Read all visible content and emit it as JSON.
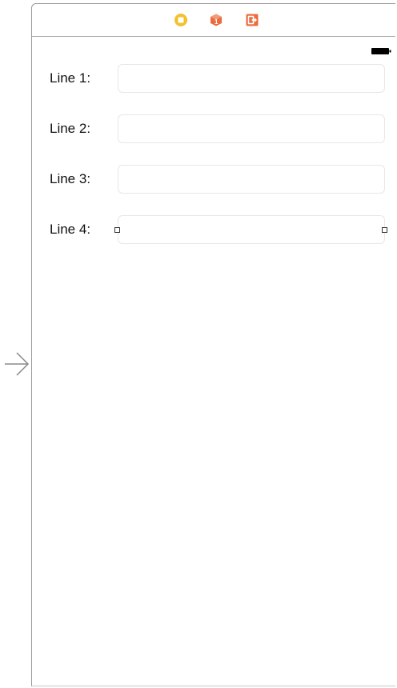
{
  "canvas": {
    "entry_arrow_icon": "entry-point-arrow-icon",
    "scene": {
      "dock": {
        "icons": [
          {
            "name": "view-controller-icon",
            "color": "#F2C12E"
          },
          {
            "name": "first-responder-icon",
            "color": "#EC6A3C"
          },
          {
            "name": "exit-icon",
            "color": "#EC6A3C"
          }
        ]
      },
      "status_bar": {
        "battery_icon": "battery-icon"
      },
      "form": {
        "rows": [
          {
            "label": "Line 1:",
            "value": "",
            "placeholder": ""
          },
          {
            "label": "Line 2:",
            "value": "",
            "placeholder": ""
          },
          {
            "label": "Line 3:",
            "value": "",
            "placeholder": ""
          },
          {
            "label": "Line 4:",
            "value": "",
            "placeholder": "",
            "selected": true
          }
        ]
      }
    }
  },
  "colors": {
    "frame_border": "#9a9a9a",
    "field_border": "#e7e7e7",
    "label_text": "#111111",
    "accent_yellow": "#F2C12E",
    "accent_orange": "#EC6A3C"
  }
}
